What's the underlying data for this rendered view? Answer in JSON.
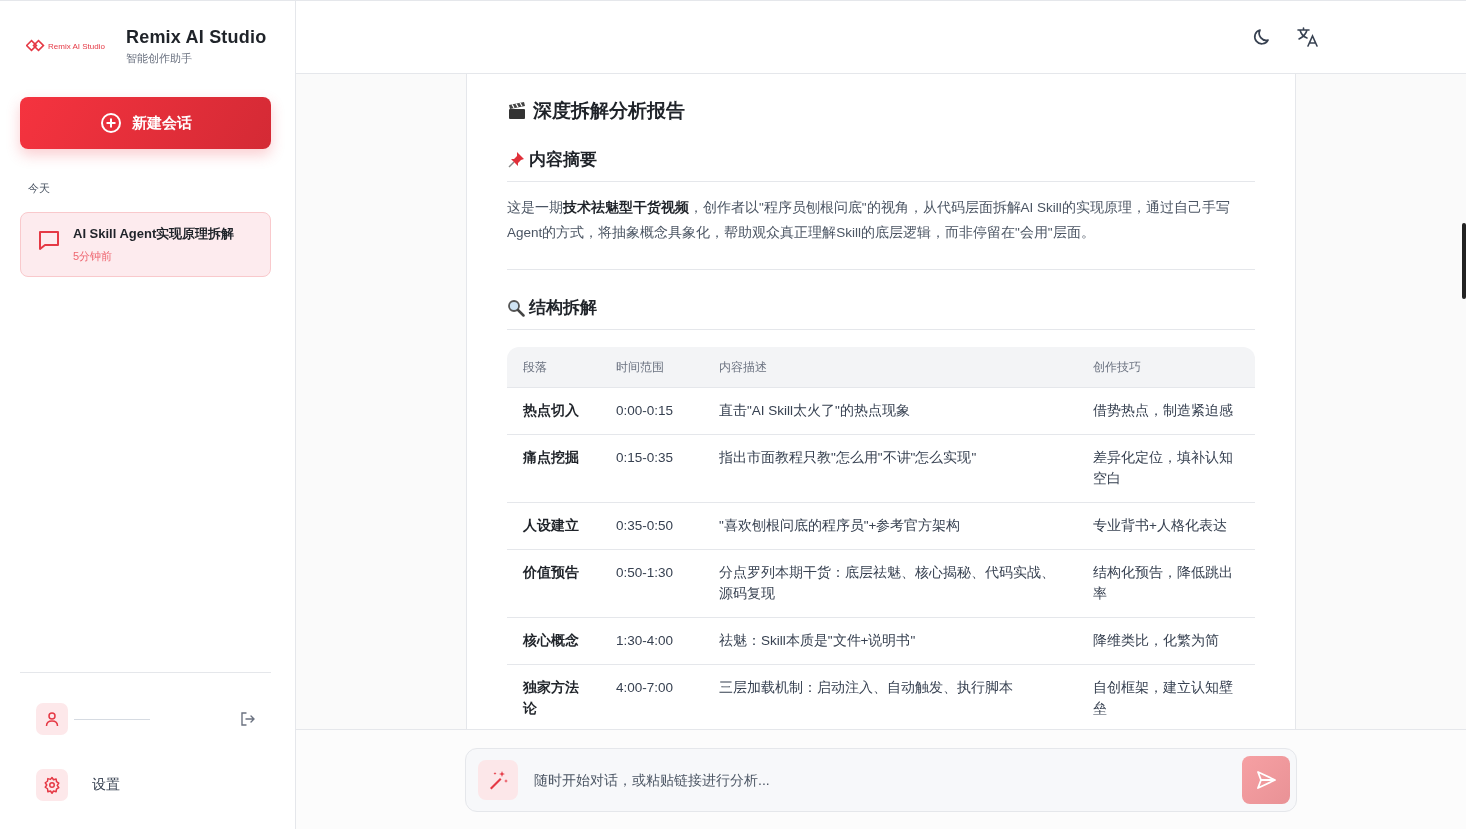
{
  "sidebar": {
    "logo_text": "Remix AI Studio",
    "app_name": "Remix AI Studio",
    "tagline": "智能创作助手",
    "new_chat_button": "新建会话",
    "group_label": "今天",
    "conversations": [
      {
        "title": "AI Skill Agent实现原理拆解",
        "time": "5分钟前",
        "selected": true
      }
    ],
    "settings_label": "设置"
  },
  "report": {
    "title": "深度拆解分析报告",
    "summary_heading": "内容摘要",
    "summary": "这是一期**技术祛魅型干货视频**，创作者以\"程序员刨根问底\"的视角，从代码层面拆解AI Skill的实现原理，通过自己手写Agent的方式，将抽象概念具象化，帮助观众真正理解Skill的底层逻辑，而非停留在\"会用\"层面。",
    "structure_heading": "结构拆解",
    "table": {
      "columns": [
        "段落",
        "时间范围",
        "内容描述",
        "创作技巧"
      ],
      "rows": [
        [
          "热点切入",
          "0:00-0:15",
          "直击\"AI Skill太火了\"的热点现象",
          "借势热点，制造紧迫感"
        ],
        [
          "痛点挖掘",
          "0:15-0:35",
          "指出市面教程只教\"怎么用\"不讲\"怎么实现\"",
          "差异化定位，填补认知空白"
        ],
        [
          "人设建立",
          "0:35-0:50",
          "\"喜欢刨根问底的程序员\"+参考官方架构",
          "专业背书+人格化表达"
        ],
        [
          "价值预告",
          "0:50-1:30",
          "分点罗列本期干货：底层祛魅、核心揭秘、代码实战、源码复现",
          "结构化预告，降低跳出率"
        ],
        [
          "核心概念",
          "1:30-4:00",
          "祛魅：Skill本质是\"文件+说明书\"",
          "降维类比，化繁为简"
        ],
        [
          "独家方法论",
          "4:00-7:00",
          "三层加载机制：启动注入、自动触发、执行脚本",
          "自创框架，建立认知壁垒"
        ]
      ]
    }
  },
  "composer": {
    "placeholder": "随时开始对话，或粘贴链接进行分析..."
  }
}
